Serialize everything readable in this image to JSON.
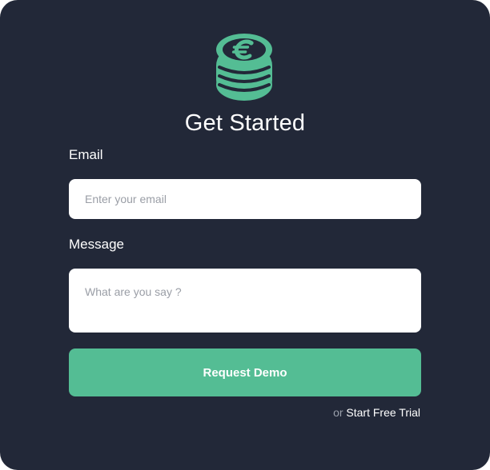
{
  "header": {
    "logo_icon": "euro-coin-stack-icon",
    "title": "Get Started"
  },
  "form": {
    "email_label": "Email",
    "email_placeholder": "Enter your email",
    "email_value": "",
    "message_label": "Message",
    "message_placeholder": "What are you say ?",
    "message_value": "",
    "submit_label": "Request Demo"
  },
  "footer": {
    "or_text": "or",
    "trial_link": "Start Free Trial"
  },
  "colors": {
    "background": "#222838",
    "accent": "#54bd94",
    "input_background": "#ffffff",
    "placeholder": "#9a9ea6"
  }
}
